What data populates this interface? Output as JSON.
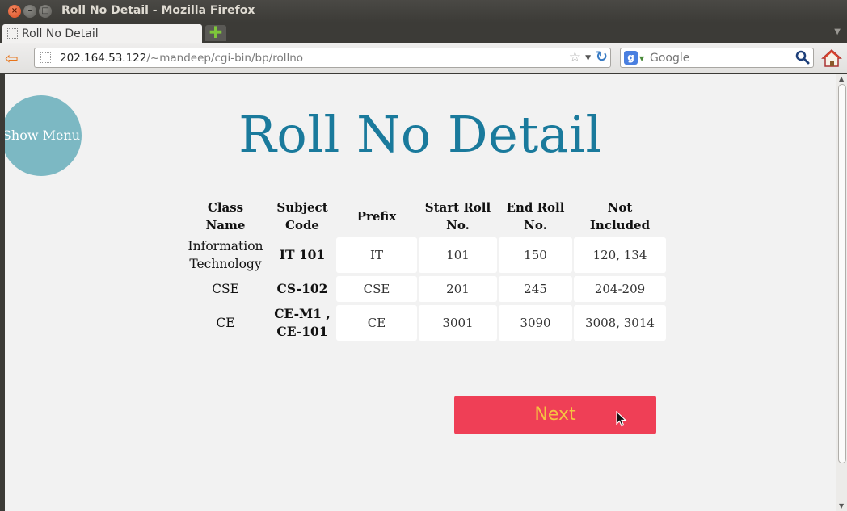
{
  "window": {
    "title": "Roll No Detail - Mozilla Firefox"
  },
  "tab": {
    "title": "Roll No Detail",
    "new_tab_symbol": "✚"
  },
  "nav": {
    "url_host": "202.164.53.122",
    "url_path": "/~mandeep/cgi-bin/bp/rollno",
    "search_placeholder": "Google"
  },
  "page": {
    "menu_label": "Show Menu",
    "heading": "Roll No Detail",
    "table": {
      "headers": {
        "class_name": "Class Name",
        "subject_code": "Subject Code",
        "prefix": "Prefix",
        "start_roll": "Start Roll No.",
        "end_roll": "End Roll No.",
        "not_included": "Not Included"
      },
      "rows": [
        {
          "class_name": "Information Technology",
          "subject_code": "IT 101",
          "prefix": "IT",
          "start_roll": "101",
          "end_roll": "150",
          "not_included": "120, 134"
        },
        {
          "class_name": "CSE",
          "subject_code": "CS-102",
          "prefix": "CSE",
          "start_roll": "201",
          "end_roll": "245",
          "not_included": "204-209"
        },
        {
          "class_name": "CE",
          "subject_code": "CE-M1 , CE-101",
          "prefix": "CE",
          "start_roll": "3001",
          "end_roll": "3090",
          "not_included": "3008, 3014"
        }
      ]
    },
    "next_label": "Next"
  },
  "colors": {
    "heading": "#1a7a9c",
    "menu_circle": "#7cb8c3",
    "next_button": "#ef3f56",
    "next_text": "#f4c341",
    "page_bg": "#f2f2f2"
  },
  "icons": [
    "close-icon",
    "minimize-icon",
    "maximize-icon",
    "back-arrow-icon",
    "bookmark-star-icon",
    "reload-icon",
    "search-icon",
    "home-icon",
    "mouse-cursor-icon"
  ]
}
